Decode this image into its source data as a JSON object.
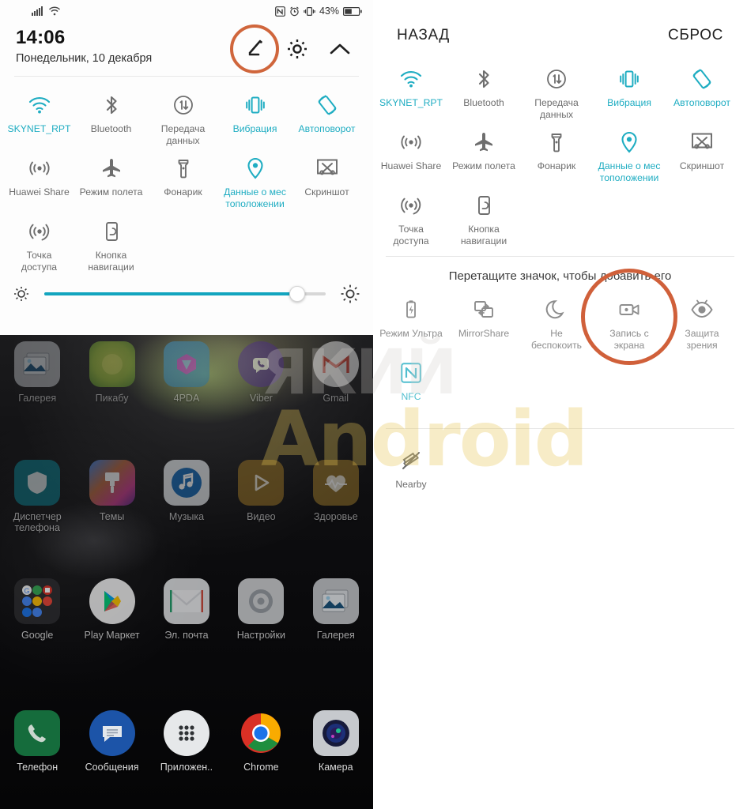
{
  "statusbar": {
    "signal_icon": "cellular-signal-icon",
    "wifi_icon": "wifi-icon",
    "nfc_icon": "nfc-icon",
    "alarm_icon": "alarm-clock-icon",
    "vibrate_icon": "vibrate-icon",
    "battery_percent": "43%",
    "battery_icon": "battery-icon"
  },
  "shade": {
    "time": "14:06",
    "date": "Понедельник, 10 декабря",
    "edit_icon": "edit-pencil-icon",
    "settings_icon": "gear-icon",
    "collapse_icon": "chevron-up-icon",
    "edit_highlighted": true,
    "brightness": {
      "low_icon": "brightness-low-icon",
      "high_icon": "brightness-high-icon",
      "value_percent": 90
    },
    "tiles": [
      {
        "label": "SKYNET_RPT",
        "icon": "wifi-icon",
        "state": "on"
      },
      {
        "label": "Bluetooth",
        "icon": "bluetooth-icon",
        "state": "off"
      },
      {
        "label": "Передача\nданных",
        "icon": "mobile-data-icon",
        "state": "off"
      },
      {
        "label": "Вибрация",
        "icon": "vibrate-icon",
        "state": "on"
      },
      {
        "label": "Автоповорот",
        "icon": "auto-rotate-icon",
        "state": "on"
      },
      {
        "label": "Huawei Share",
        "icon": "huawei-share-icon",
        "state": "off"
      },
      {
        "label": "Режим полета",
        "icon": "airplane-icon",
        "state": "off"
      },
      {
        "label": "Фонарик",
        "icon": "flashlight-icon",
        "state": "off"
      },
      {
        "label": "Данные о мес\nтоположении",
        "icon": "location-pin-icon",
        "state": "on"
      },
      {
        "label": "Скриншот",
        "icon": "screenshot-icon",
        "state": "off"
      },
      {
        "label": "Точка\nдоступа",
        "icon": "hotspot-icon",
        "state": "off"
      },
      {
        "label": "Кнопка\nнавигации",
        "icon": "nav-button-icon",
        "state": "off"
      }
    ]
  },
  "edit_panel": {
    "back_label": "НАЗАД",
    "reset_label": "СБРОС",
    "drag_hint": "Перетащите значок, чтобы добавить его",
    "active_tiles": [
      {
        "label": "SKYNET_RPT",
        "icon": "wifi-icon",
        "state": "on"
      },
      {
        "label": "Bluetooth",
        "icon": "bluetooth-icon",
        "state": "off"
      },
      {
        "label": "Передача\nданных",
        "icon": "mobile-data-icon",
        "state": "off"
      },
      {
        "label": "Вибрация",
        "icon": "vibrate-icon",
        "state": "on"
      },
      {
        "label": "Автоповорот",
        "icon": "auto-rotate-icon",
        "state": "on"
      },
      {
        "label": "Huawei Share",
        "icon": "huawei-share-icon",
        "state": "off"
      },
      {
        "label": "Режим полета",
        "icon": "airplane-icon",
        "state": "off"
      },
      {
        "label": "Фонарик",
        "icon": "flashlight-icon",
        "state": "off"
      },
      {
        "label": "Данные о мес\nтоположении",
        "icon": "location-pin-icon",
        "state": "on"
      },
      {
        "label": "Скриншот",
        "icon": "screenshot-icon",
        "state": "off"
      },
      {
        "label": "Точка\nдоступа",
        "icon": "hotspot-icon",
        "state": "off"
      },
      {
        "label": "Кнопка\nнавигации",
        "icon": "nav-button-icon",
        "state": "off"
      }
    ],
    "available_tiles": [
      {
        "label": "Режим Ультра",
        "icon": "ultra-power-saving-icon",
        "state": "off",
        "highlighted": false
      },
      {
        "label": "MirrorShare",
        "icon": "mirrorshare-icon",
        "state": "off",
        "highlighted": false
      },
      {
        "label": "Не\nбеспокоить",
        "icon": "do-not-disturb-moon-icon",
        "state": "off",
        "highlighted": false
      },
      {
        "label": "Запись с\nэкрана",
        "icon": "screen-record-icon",
        "state": "off",
        "highlighted": true
      },
      {
        "label": "Защита\nзрения",
        "icon": "eye-comfort-icon",
        "state": "off",
        "highlighted": false
      },
      {
        "label": "NFC",
        "icon": "nfc-icon",
        "state": "on",
        "highlighted": false
      }
    ],
    "bottom_tiles": [
      {
        "label": "Nearby",
        "icon": "nearby-icon",
        "state": "off"
      }
    ]
  },
  "home_screen": {
    "rows": [
      [
        {
          "label": "Галерея",
          "icon": "gallery-icon"
        },
        {
          "label": "Пикабу",
          "icon": "pikabu-icon"
        },
        {
          "label": "4PDA",
          "icon": "fourpda-icon"
        },
        {
          "label": "Viber",
          "icon": "viber-icon"
        },
        {
          "label": "Gmail",
          "icon": "gmail-icon"
        }
      ],
      [
        {
          "label": "Диспетчер\nтелефона",
          "icon": "phone-manager-icon"
        },
        {
          "label": "Темы",
          "icon": "themes-icon"
        },
        {
          "label": "Музыка",
          "icon": "music-icon"
        },
        {
          "label": "Видео",
          "icon": "video-icon"
        },
        {
          "label": "Здоровье",
          "icon": "health-icon"
        }
      ],
      [
        {
          "label": "Google",
          "icon": "google-folder-icon"
        },
        {
          "label": "Play Маркет",
          "icon": "play-store-icon"
        },
        {
          "label": "Эл. почта",
          "icon": "email-icon"
        },
        {
          "label": "Настройки",
          "icon": "settings-gear-icon"
        },
        {
          "label": "Галерея",
          "icon": "gallery-icon"
        }
      ],
      [
        {
          "label": "Телефон",
          "icon": "phone-icon"
        },
        {
          "label": "Сообщения",
          "icon": "messages-icon"
        },
        {
          "label": "Приложен..",
          "icon": "app-drawer-icon"
        },
        {
          "label": "Chrome",
          "icon": "chrome-icon"
        },
        {
          "label": "Камера",
          "icon": "camera-icon"
        }
      ]
    ]
  },
  "watermark": {
    "line1": "ЯКИЙ",
    "line2": "Android"
  },
  "colors": {
    "accent_teal": "#1fadc2",
    "highlight_orange": "#d0663c",
    "inactive_gray": "#6b6b6b"
  }
}
